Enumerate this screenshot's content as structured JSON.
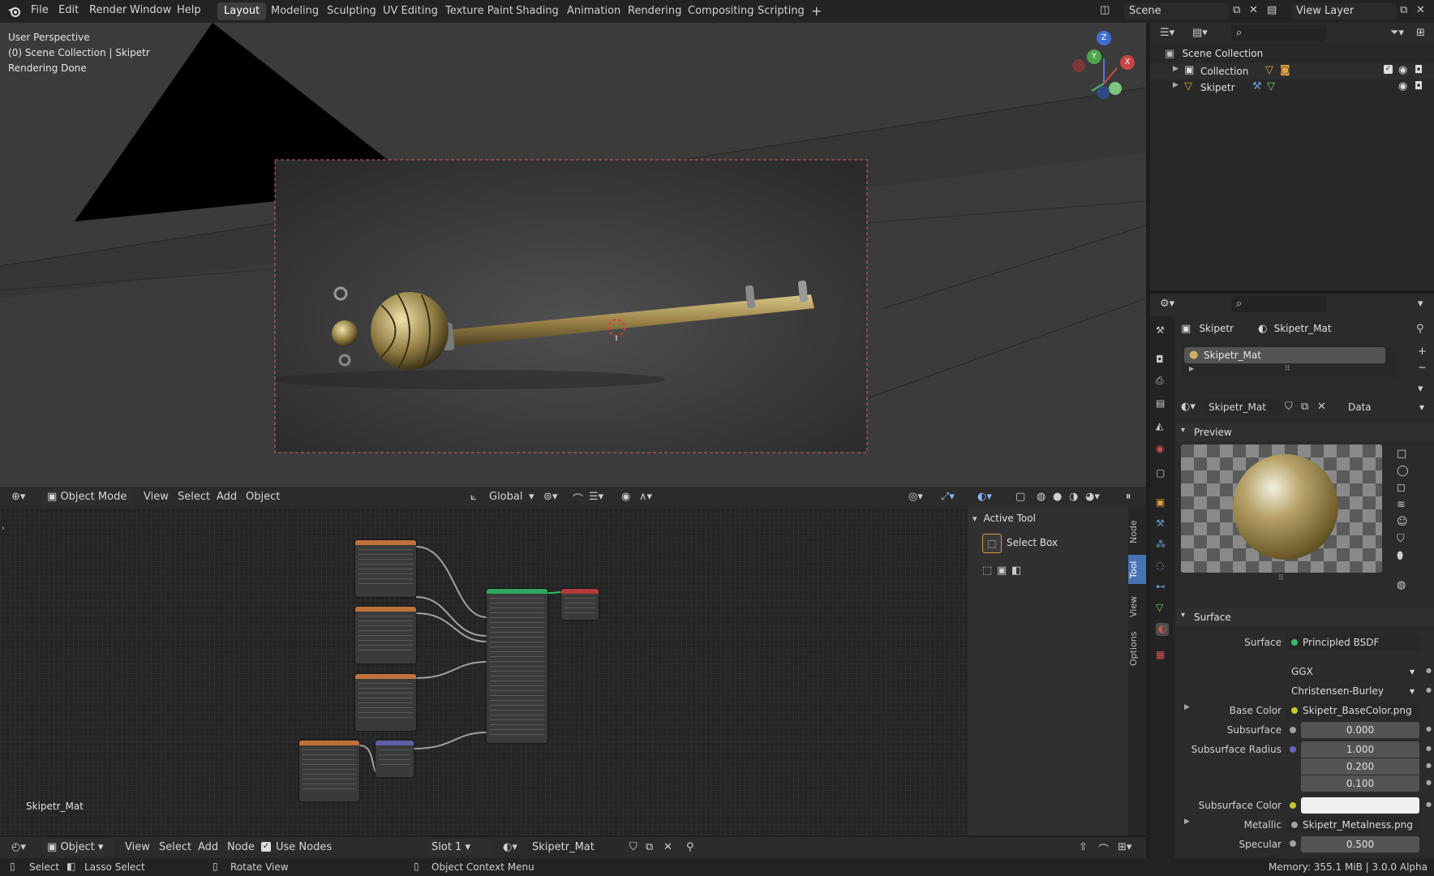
{
  "topbar": {
    "menus": [
      "File",
      "Edit",
      "Render",
      "Window",
      "Help"
    ],
    "workspaces": [
      "Layout",
      "Modeling",
      "Sculpting",
      "UV Editing",
      "Texture Paint",
      "Shading",
      "Animation",
      "Rendering",
      "Compositing",
      "Scripting"
    ],
    "active_workspace": "Layout",
    "add_tab": "+",
    "scene": "Scene",
    "view_layer": "View Layer"
  },
  "viewport": {
    "overlay_line1": "User Perspective",
    "overlay_line2": "(0) Scene Collection | Skipetr",
    "overlay_line3": "Rendering Done",
    "gizmo": {
      "z": "Z",
      "y": "Y",
      "x": "X"
    },
    "header": {
      "mode": "Object Mode",
      "menus": [
        "View",
        "Select",
        "Add",
        "Object"
      ],
      "transform": "Global"
    }
  },
  "node_editor": {
    "material_label": "Skipetr_Mat",
    "header": {
      "editor": "Object",
      "menus": [
        "View",
        "Select",
        "Add",
        "Node"
      ],
      "use_nodes": "Use Nodes",
      "slot": "Slot 1",
      "material": "Skipetr_Mat"
    }
  },
  "side_panel": {
    "section": "Active Tool",
    "tool_name": "Select Box",
    "tabs": [
      "Node",
      "Tool",
      "View",
      "Options"
    ]
  },
  "outliner": {
    "root": "Scene Collection",
    "items": [
      {
        "label": "Collection"
      },
      {
        "label": "Skipetr"
      }
    ]
  },
  "properties": {
    "object_name": "Skipetr",
    "material_name": "Skipetr_Mat",
    "slot_item": "Skipetr_Mat",
    "data_dropdown": "Data",
    "preview_label": "Preview",
    "surface_section": "Surface",
    "rows": {
      "surface_label": "Surface",
      "surface_value": "Principled BSDF",
      "distribution": "GGX",
      "subsurface_method": "Christensen-Burley",
      "base_color_label": "Base Color",
      "base_color_value": "Skipetr_BaseColor.png",
      "subsurface_label": "Subsurface",
      "subsurface_value": "0.000",
      "subsurface_radius_label": "Subsurface Radius",
      "subsurface_radius": [
        "1.000",
        "0.200",
        "0.100"
      ],
      "subsurface_color_label": "Subsurface Color",
      "metallic_label": "Metallic",
      "metallic_value": "Skipetr_Metalness.png",
      "specular_label": "Specular",
      "specular_value": "0.500"
    }
  },
  "statusbar": {
    "select": "Select",
    "lasso": "Lasso Select",
    "rotate": "Rotate View",
    "context": "Object Context Menu",
    "memory": "Memory: 355.1 MiB | 3.0.0 Alpha"
  },
  "colors": {
    "accent_blue": "#4772b3",
    "link_yellow": "#c7c729",
    "link_green": "#2fc06a",
    "link_purple": "#6363c7",
    "link_gray": "#a1a1a1"
  }
}
